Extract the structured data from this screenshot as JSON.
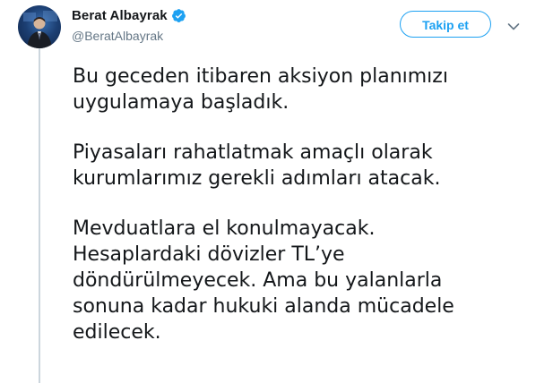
{
  "user": {
    "display_name": "Berat Albayrak",
    "handle": "@BeratAlbayrak",
    "verified": true
  },
  "actions": {
    "follow_label": "Takip et",
    "menu_icon": "chevron-down-icon"
  },
  "tweet": {
    "paragraphs": [
      {
        "lines": [
          "Bu geceden itibaren aksiyon planımızı",
          "uygulamaya başladık."
        ]
      },
      {
        "lines": [
          "Piyasaları rahatlatmak amaçlı olarak",
          "kurumlarımız gerekli adımları atacak."
        ]
      },
      {
        "lines": [
          "Mevduatlara el konulmayacak.",
          "Hesaplardaki dövizler TL’ye",
          "döndürülmeyecek. Ama bu yalanlarla",
          "sonuna kadar hukuki alanda mücadele",
          "edilecek."
        ]
      }
    ]
  },
  "colors": {
    "accent": "#1da1f2",
    "text": "#14171a",
    "secondary_text": "#657786",
    "thread_line": "#ccd6dd"
  }
}
